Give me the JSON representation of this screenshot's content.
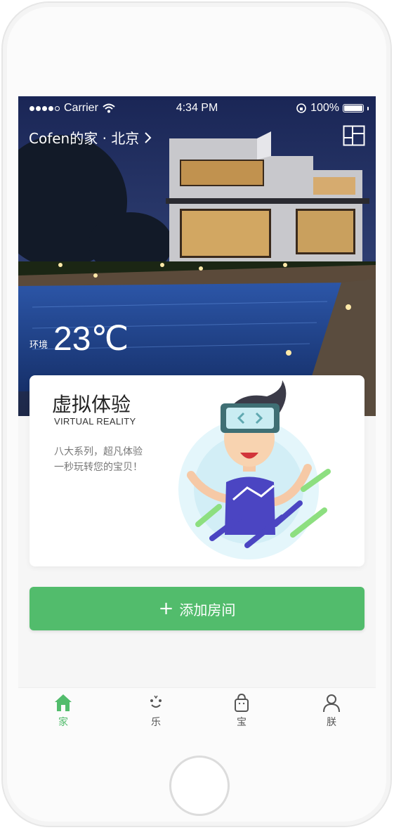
{
  "status_bar": {
    "carrier": "Carrier",
    "time": "4:34 PM",
    "battery": "100%"
  },
  "header": {
    "home_name": "Cofen的家 · 北京",
    "chevron": "chevron-right-icon",
    "layout_icon": "grid-layout-icon"
  },
  "environment": {
    "label": "环境",
    "temperature": "23℃"
  },
  "vr_card": {
    "title": "虚拟体验",
    "subtitle": "VIRTUAL REALITY",
    "desc_line1": "八大系列，超凡体验",
    "desc_line2": "一秒玩转您的宝贝！"
  },
  "add_room": {
    "label": "添加房间",
    "icon": "plus-icon"
  },
  "tabs": [
    {
      "label": "家",
      "icon": "home-icon",
      "active": true
    },
    {
      "label": "乐",
      "icon": "smile-icon",
      "active": false
    },
    {
      "label": "宝",
      "icon": "bag-icon",
      "active": false
    },
    {
      "label": "朕",
      "icon": "user-icon",
      "active": false
    }
  ],
  "colors": {
    "accent": "#52bc6c",
    "text_dark": "#222222",
    "text_muted": "#777777"
  }
}
